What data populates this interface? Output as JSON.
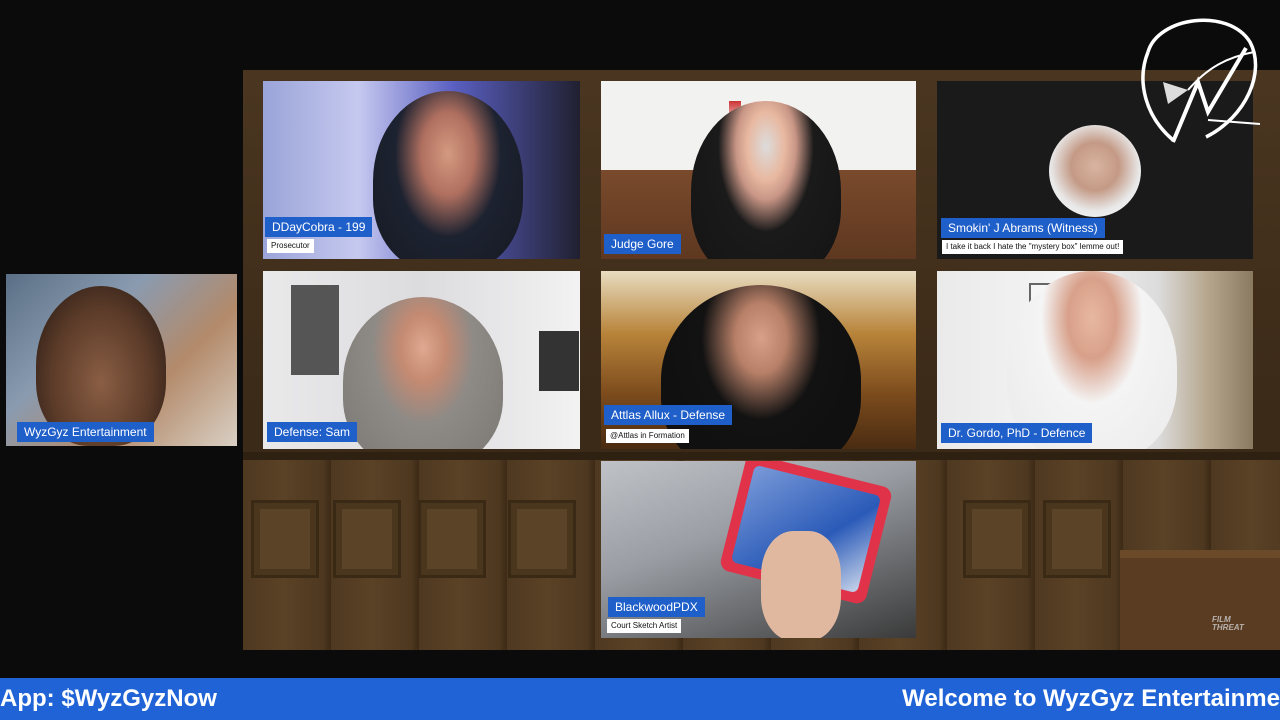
{
  "participants": [
    {
      "id": "wyzgyz",
      "name": "WyzGyz Entertainment",
      "subtitle": ""
    },
    {
      "id": "ddaycobra",
      "name": "DDayCobra - 199",
      "subtitle": "Prosecutor"
    },
    {
      "id": "judge",
      "name": "Judge Gore",
      "subtitle": ""
    },
    {
      "id": "witness",
      "name": "Smokin' J Abrams (Witness)",
      "subtitle": "I take it back I hate the \"mystery box\" lemme out!"
    },
    {
      "id": "sam",
      "name": "Defense: Sam",
      "subtitle": ""
    },
    {
      "id": "attlas",
      "name": "Attlas Allux - Defense",
      "subtitle": "@Attlas in Formation"
    },
    {
      "id": "gordo",
      "name": "Dr. Gordo, PhD - Defence",
      "subtitle": ""
    },
    {
      "id": "blackwood",
      "name": "BlackwoodPDX",
      "subtitle": "Court Sketch Artist"
    }
  ],
  "ticker": {
    "left_text": "App: $WyzGyzNow",
    "right_text": "Welcome to WyzGyz Entertainme"
  },
  "watermark": {
    "line1": "FILM",
    "line2": "THREAT"
  },
  "colors": {
    "tag_blue": "#1f5fc9",
    "ticker_blue": "#1f63d6",
    "background": "#0b0b0b"
  }
}
